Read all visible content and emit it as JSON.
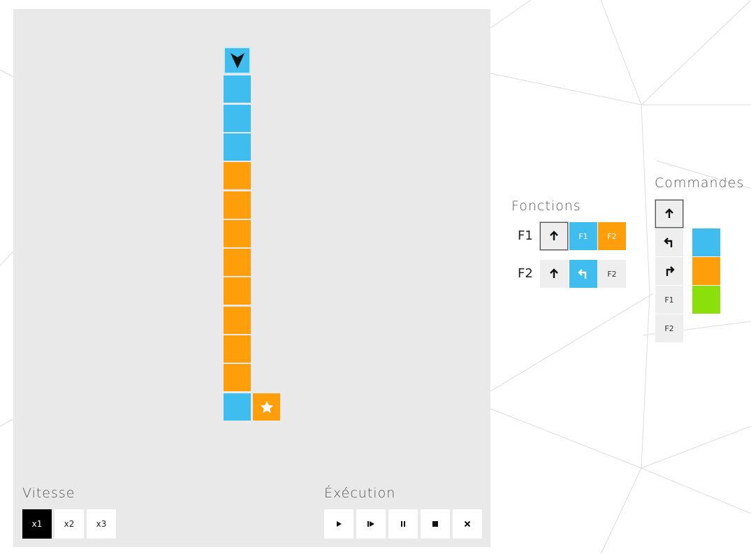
{
  "speed": {
    "title": "Vitesse",
    "options": [
      {
        "label": "x1",
        "active": true
      },
      {
        "label": "x2",
        "active": false
      },
      {
        "label": "x3",
        "active": false
      }
    ]
  },
  "execution": {
    "title": "Éxécution",
    "controls": [
      "play-icon",
      "step-icon",
      "pause-icon",
      "stop-icon",
      "close-icon"
    ]
  },
  "functions": {
    "title": "Fonctions",
    "rows": [
      {
        "label": "F1",
        "slots": [
          {
            "content": "forward-icon",
            "color": "none",
            "selected": true
          },
          {
            "content": "F1",
            "color": "blue"
          },
          {
            "content": "F2",
            "color": "orange"
          }
        ]
      },
      {
        "label": "F2",
        "slots": [
          {
            "content": "forward-icon",
            "color": "none"
          },
          {
            "content": "turn-left-icon",
            "color": "blue"
          },
          {
            "content": "F2",
            "color": "none"
          }
        ]
      }
    ]
  },
  "commands": {
    "title": "Commandes",
    "items": [
      "forward-icon",
      "turn-left-icon",
      "turn-right-icon",
      "F1",
      "F2"
    ],
    "colors": [
      "#3ebdee",
      "#ff9e0b",
      "#8be00c"
    ]
  },
  "colors": {
    "blue": "#3ebdee",
    "orange": "#ff9e0b",
    "green": "#8be00c",
    "board": "#e9e9e9"
  },
  "grid": {
    "robot": {
      "cell": "top of column",
      "facing": "down"
    },
    "column_colors_top_to_bottom": [
      "blue",
      "blue",
      "blue",
      "blue",
      "orange",
      "orange",
      "orange",
      "orange",
      "orange",
      "orange",
      "orange",
      "orange",
      "blue"
    ],
    "goal": {
      "icon": "star-icon",
      "color": "orange",
      "position": "right of bottom cell"
    }
  }
}
